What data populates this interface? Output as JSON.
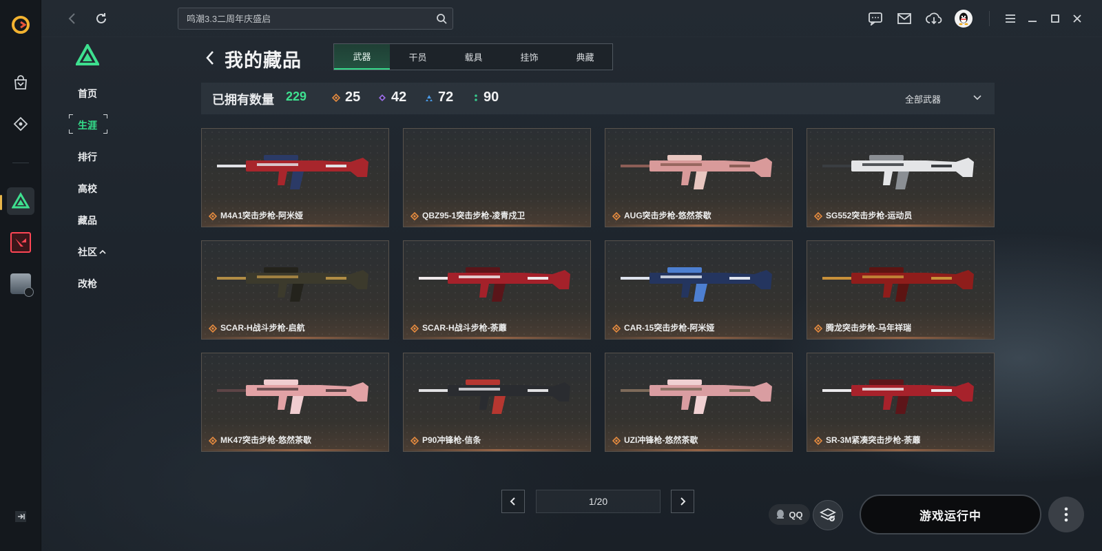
{
  "search": {
    "placeholder": "鸣潮3.3二周年庆盛启"
  },
  "subnav": {
    "items": [
      {
        "label": "首页"
      },
      {
        "label": "生涯"
      },
      {
        "label": "排行"
      },
      {
        "label": "高校"
      },
      {
        "label": "藏品"
      },
      {
        "label": "社区"
      },
      {
        "label": "改枪"
      }
    ],
    "active_index": 1
  },
  "header": {
    "title": "我的藏品"
  },
  "tabs": [
    {
      "label": "武器"
    },
    {
      "label": "干员"
    },
    {
      "label": "载具"
    },
    {
      "label": "挂饰"
    },
    {
      "label": "典藏"
    }
  ],
  "stats": {
    "owned_label": "已拥有数量",
    "owned_count": "229",
    "tiers": [
      {
        "value": "25",
        "color": "#e58b3f",
        "icon": "diamond-orange-icon"
      },
      {
        "value": "42",
        "color": "#9a6ce6",
        "icon": "diamond-purple-icon"
      },
      {
        "value": "72",
        "color": "#4a9be8",
        "icon": "triangle-blue-icon"
      },
      {
        "value": "90",
        "color": "#37c98c",
        "icon": "dots-green-icon"
      }
    ],
    "filter_label": "全部武器"
  },
  "weapons": [
    {
      "name": "M4A1突击步枪-阿米娅",
      "palette": [
        "#a8262c",
        "#e1e2e6",
        "#2b3a66"
      ]
    },
    {
      "name": "QBZ95-1突击步枪-凌青戍卫",
      "palette": []
    },
    {
      "name": "AUG突击步枪-悠然茶歇",
      "palette": [
        "#d99a9a",
        "#8c5e56",
        "#e8c6c0"
      ]
    },
    {
      "name": "SG552突击步枪-运动员",
      "palette": [
        "#e4e5e7",
        "#3a3d41",
        "#8b8f94"
      ]
    },
    {
      "name": "SCAR-H战斗步枪-启航",
      "palette": [
        "#3c3a2c",
        "#b18d45",
        "#24231c"
      ]
    },
    {
      "name": "SCAR-H战斗步枪-荼蘼",
      "palette": [
        "#a4212a",
        "#efe9ea",
        "#5a1519"
      ]
    },
    {
      "name": "CAR-15突击步枪-阿米娅",
      "palette": [
        "#24355f",
        "#dfe4ee",
        "#4d7fd1"
      ]
    },
    {
      "name": "腾龙突击步枪-马年祥瑞",
      "palette": [
        "#8f1d1b",
        "#c8913a",
        "#5c1412"
      ]
    },
    {
      "name": "MK47突击步枪-悠然茶歇",
      "palette": [
        "#e2a2a5",
        "#5d4446",
        "#f0cdd0"
      ]
    },
    {
      "name": "P90冲锋枪-信条",
      "palette": [
        "#2a2c30",
        "#e2e2e4",
        "#b63730"
      ]
    },
    {
      "name": "UZI冲锋枪-悠然茶歇",
      "palette": [
        "#d99da1",
        "#7e6b5a",
        "#f0d0d2"
      ]
    },
    {
      "name": "SR-3M紧凑突击步枪-荼蘼",
      "palette": [
        "#a7222b",
        "#ecebed",
        "#5d1519"
      ]
    }
  ],
  "pagination": {
    "label": "1/20"
  },
  "bottom": {
    "qq_label": "QQ",
    "run_label": "游戏运行中"
  }
}
